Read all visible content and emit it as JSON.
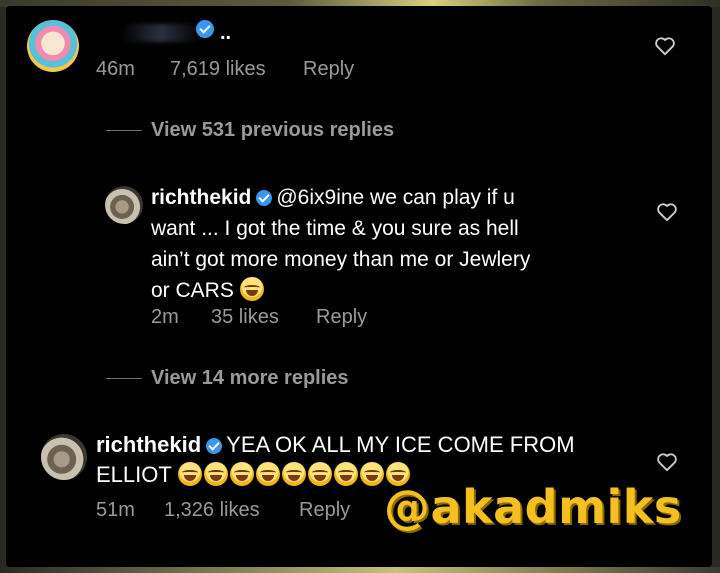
{
  "comment1": {
    "after_username": "..",
    "time": "46m",
    "likes": "7,619 likes",
    "reply_label": "Reply"
  },
  "view_previous": "View 531 previous replies",
  "reply1": {
    "username": "richthekid",
    "line1": "@6ix9ine we can play if u",
    "line2": "want ... I got the time & you sure as hell",
    "line3": "ain’t got more money than me or Jewlery",
    "line4": "or CARS",
    "time": "2m",
    "likes": "35 likes",
    "reply_label": "Reply"
  },
  "view_more": "View 14 more replies",
  "comment2": {
    "username": "richthekid",
    "line1": "YEA OK ALL MY ICE COME FROM",
    "line2": "ELLIOT",
    "emoji_count": 9,
    "time": "51m",
    "likes": "1,326 likes",
    "reply_label": "Reply"
  },
  "watermark": "@akadmiks",
  "icons": {
    "heart": "heart-icon",
    "verified": "verified-badge-icon",
    "laughing": "laughing-emoji-icon"
  },
  "colors": {
    "background": "#000000",
    "text": "#ffffff",
    "muted": "#9a9a9a",
    "verified": "#3897f0",
    "watermark": "#f4c020"
  }
}
